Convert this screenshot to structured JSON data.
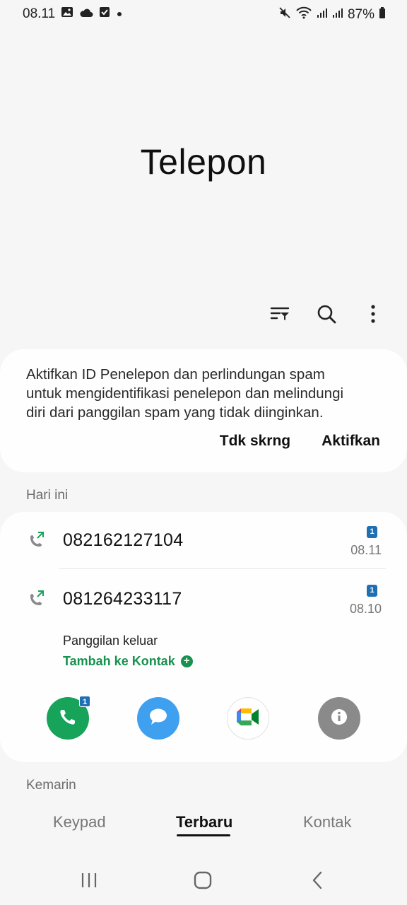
{
  "status_bar": {
    "time": "08.11",
    "battery": "87%",
    "left_icons": [
      "image-icon",
      "cloud-icon",
      "checkbox-icon",
      "dot-icon"
    ],
    "right_icons": [
      "mute-icon",
      "wifi-icon",
      "signal-icon",
      "signal-icon",
      "battery-icon"
    ]
  },
  "header": {
    "title": "Telepon"
  },
  "toolbar": {
    "icons": [
      "filter-icon",
      "search-icon",
      "more-icon"
    ]
  },
  "spam_card": {
    "line1": "Aktifkan ID Penelepon dan perlindungan spam",
    "line2": "untuk mengidentifikasi penelepon dan melindungi",
    "line3": "diri dari panggilan spam yang tidak diinginkan.",
    "dismiss_label": "Tdk skrng",
    "enable_label": "Aktifkan"
  },
  "sections": {
    "today": "Hari ini",
    "yesterday": "Kemarin"
  },
  "calls": [
    {
      "number": "082162127104",
      "sim": "1",
      "time": "08.11"
    },
    {
      "number": "081264233117",
      "sim": "1",
      "time": "08.10"
    }
  ],
  "expanded_call": {
    "type": "Panggilan keluar",
    "add_contact": "Tambah ke Kontak",
    "call_badge": "1"
  },
  "colors": {
    "call_green": "#17a35a",
    "message_blue": "#3fa0f0",
    "info_gray": "#8a8a8a",
    "link_green": "#17914e",
    "sim_blue": "#1f6fb3"
  },
  "tabs": {
    "keypad": "Keypad",
    "recent": "Terbaru",
    "contacts": "Kontak",
    "active": "Terbaru"
  }
}
